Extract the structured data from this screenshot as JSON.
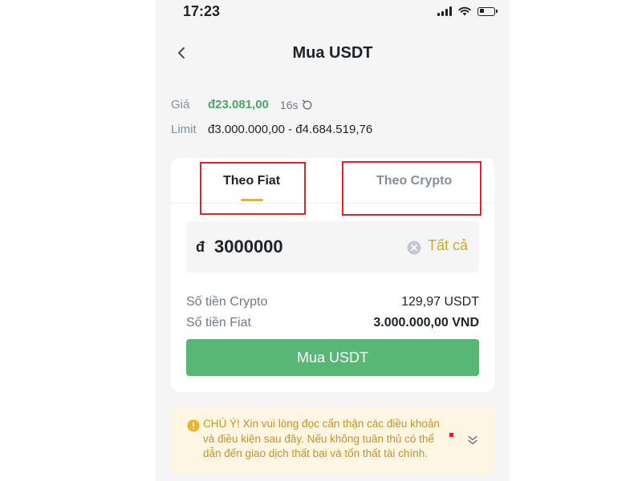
{
  "status_bar": {
    "time": "17:23",
    "battery_level": 0.3
  },
  "header": {
    "title": "Mua USDT"
  },
  "price": {
    "label": "Giá",
    "value": "đ23.081,00",
    "timer": "16s"
  },
  "limit": {
    "label": "Limit",
    "value": "đ3.000.000,00 - đ4.684.519,76"
  },
  "tabs": [
    {
      "label": "Theo Fiat",
      "active": true
    },
    {
      "label": "Theo Crypto",
      "active": false
    }
  ],
  "amount_input": {
    "currency_symbol": "đ",
    "value": "3000000",
    "all_label": "Tất cả"
  },
  "summary": [
    {
      "label": "Số tiền Crypto",
      "value": "129,97 USDT"
    },
    {
      "label": "Số tiền Fiat",
      "value": "3.000.000,00 VND"
    }
  ],
  "buy_button": {
    "label": "Mua USDT"
  },
  "notice": {
    "text": "CHÚ Ý! Xin vui lòng đọc cẩn thận các điều khoản và điều kiện sau đây. Nếu không tuân thủ có thể dẫn đến giao dịch thất bại và tổn thất tài chính."
  },
  "icons": {
    "back": "chevron-left-icon",
    "refresh": "refresh-icon",
    "clear": "clear-circle-icon",
    "warning": "warning-icon",
    "expand": "double-chevron-down-icon",
    "signal": "signal-icon",
    "wifi": "wifi-icon",
    "battery": "battery-icon"
  },
  "colors": {
    "price_green": "#48a868",
    "buy_button": "#58b774",
    "accent_gold": "#d4a62a",
    "tab_underline": "#d9b54a",
    "highlight_red": "#e0202a",
    "notice_bg": "#fdf6e2",
    "notice_text": "#c9922a"
  }
}
